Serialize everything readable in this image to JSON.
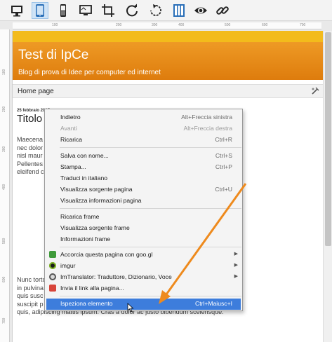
{
  "toolbar": {
    "buttons": [
      {
        "icon": "desktop-icon"
      },
      {
        "icon": "tablet-icon"
      },
      {
        "icon": "phone-icon"
      },
      {
        "icon": "monitor-icon"
      },
      {
        "icon": "crop-icon"
      },
      {
        "icon": "refresh-icon"
      },
      {
        "icon": "rotate-icon"
      },
      {
        "icon": "columns-icon"
      },
      {
        "icon": "eye-icon"
      },
      {
        "icon": "link-icon"
      }
    ],
    "active_index": 1
  },
  "ruler": {
    "h_ticks": [
      "100",
      "200",
      "300",
      "400",
      "500",
      "600",
      "700"
    ],
    "v_ticks": [
      "100",
      "200",
      "300",
      "400",
      "500",
      "600",
      "700"
    ]
  },
  "page": {
    "title": "Test di IpCe",
    "subtitle": "Blog di prova di Idee per computer ed internet",
    "nav_home": "Home page",
    "post_date": "25 febbraio 2015",
    "post_title": "Titolo",
    "para1": [
      "Maecena                                                                                  condimentum tortor lorem",
      "nec dolor                                                                                   enean ultrices porta elit. In",
      "nisl maur                                                                                  a, id scelerisque mi.",
      "Pellentes                                                                                      elit, pharetra at nunc id,",
      "eleifend c"
    ],
    "para2": [
      "Nunc torto                                                                               sit amet odio accumsan,",
      "in pulvina                                                                                 ollicitudin dapibus eros,",
      "quis susc                                                                                   Donec vel lorem eu est",
      "suscipit p                                                                                    m ipsum, egestas id enim",
      "quis, adipiscing mattis ipsum. Cras a dolor ac justo bibendum scelerisque."
    ]
  },
  "context_menu": {
    "items": [
      {
        "label": "Indietro",
        "shortcut": "Alt+Freccia sinistra",
        "disabled": false
      },
      {
        "label": "Avanti",
        "shortcut": "Alt+Freccia destra",
        "disabled": true
      },
      {
        "label": "Ricarica",
        "shortcut": "Ctrl+R",
        "disabled": false
      },
      {
        "label": "Salva con nome...",
        "shortcut": "Ctrl+S",
        "disabled": false
      },
      {
        "label": "Stampa...",
        "shortcut": "Ctrl+P",
        "disabled": false
      },
      {
        "label": "Traduci in italiano",
        "shortcut": "",
        "disabled": false
      },
      {
        "label": "Visualizza sorgente pagina",
        "shortcut": "Ctrl+U",
        "disabled": false
      },
      {
        "label": "Visualizza informazioni pagina",
        "shortcut": "",
        "disabled": false
      },
      {
        "label": "Ricarica frame",
        "shortcut": "",
        "disabled": false
      },
      {
        "label": "Visualizza sorgente frame",
        "shortcut": "",
        "disabled": false
      },
      {
        "label": "Informazioni frame",
        "shortcut": "",
        "disabled": false
      },
      {
        "label": "Accorcia questa pagina con goo.gl",
        "shortcut": "",
        "icon": "googl-icon",
        "submenu": true
      },
      {
        "label": "imgur",
        "shortcut": "",
        "icon": "imgur-icon",
        "submenu": true
      },
      {
        "label": "ImTranslator: Traduttore, Dizionario, Voce",
        "shortcut": "",
        "icon": "imtranslator-icon",
        "submenu": true
      },
      {
        "label": "Invia il link alla pagina...",
        "shortcut": "",
        "icon": "send-link-icon",
        "submenu": false
      },
      {
        "label": "Ispeziona elemento",
        "shortcut": "Ctrl+Maiusc+I",
        "highlighted": true
      }
    ]
  },
  "colors": {
    "header": "#e88c16",
    "top_band": "#f3bb1b",
    "highlight": "#3d7ddc",
    "arrow": "#ee8a1d"
  }
}
